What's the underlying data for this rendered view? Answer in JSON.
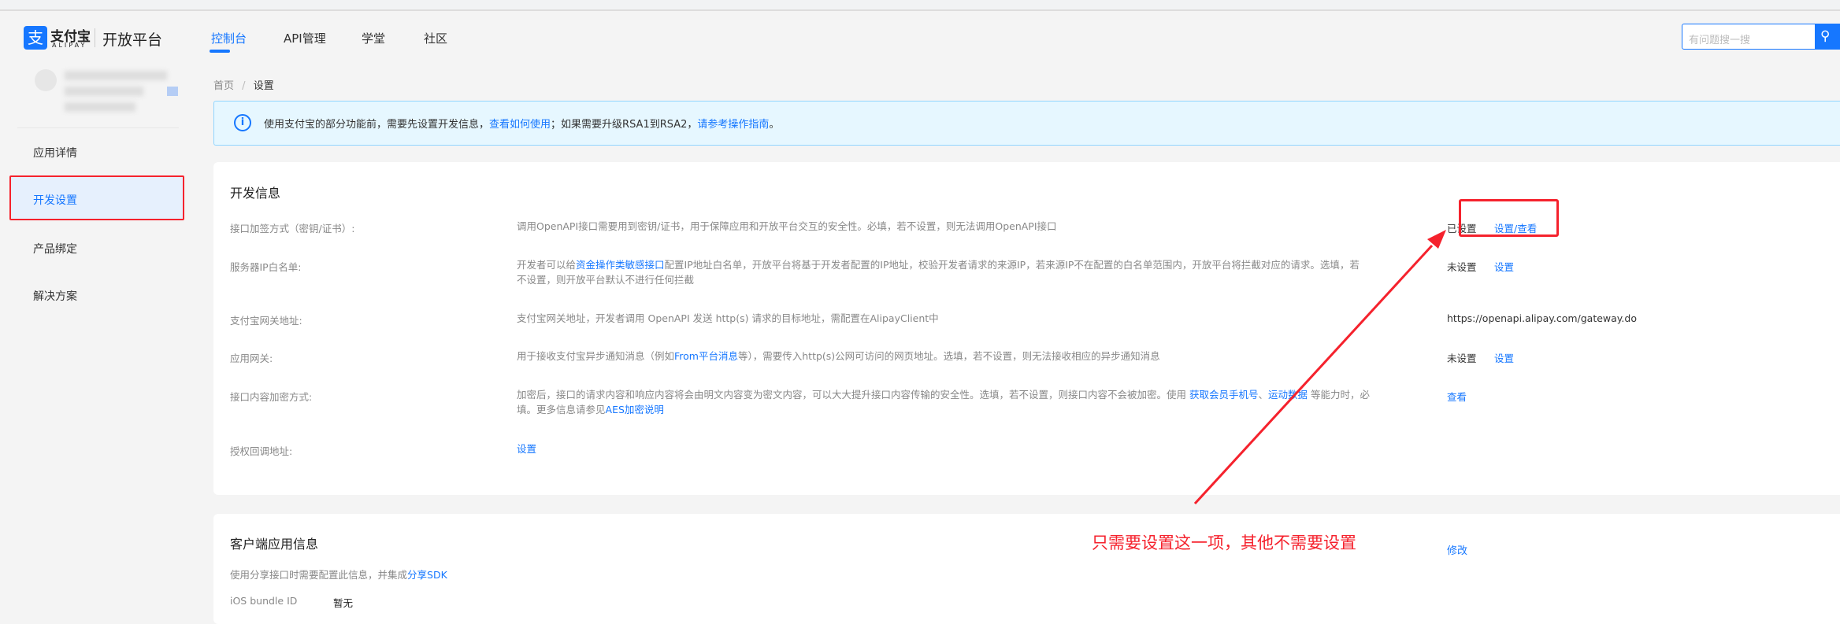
{
  "header": {
    "logo_cn": "支付宝",
    "logo_en": "ALIPAY",
    "platform": "开放平台",
    "nav": [
      {
        "label": "控制台",
        "active": true
      },
      {
        "label": "API管理"
      },
      {
        "label": "学堂"
      },
      {
        "label": "社区"
      }
    ],
    "search_placeholder": "有问题搜一搜"
  },
  "sidebar": {
    "items": [
      {
        "label": "应用详情"
      },
      {
        "label": "开发设置",
        "active": true
      },
      {
        "label": "产品绑定"
      },
      {
        "label": "解决方案"
      }
    ]
  },
  "breadcrumb": {
    "home": "首页",
    "sep": "/",
    "current": "设置"
  },
  "alert": {
    "text1": "使用支付宝的部分功能前，需要先设置开发信息，",
    "link1": "查看如何使用",
    "text2": "；如果需要升级RSA1到RSA2，",
    "link2": "请参考操作指南",
    "text3": "。"
  },
  "dev_info": {
    "title": "开发信息",
    "rows": [
      {
        "label": "接口加签方式（密钥/证书）:",
        "desc": "调用OpenAPI接口需要用到密钥/证书，用于保障应用和开放平台交互的安全性。必填，若不设置，则无法调用OpenAPI接口",
        "status": "已设置",
        "action": "设置/查看"
      },
      {
        "label": "服务器IP白名单:",
        "desc_pre": "开发者可以给",
        "desc_link": "资金操作类敏感接口",
        "desc_post": "配置IP地址白名单，开放平台将基于开发者配置的IP地址，校验开发者请求的来源IP，若来源IP不在配置的白名单范围内，开放平台将拦截对应的请求。选填，若不设置，则开放平台默认不进行任何拦截",
        "status": "未设置",
        "action": "设置"
      },
      {
        "label": "支付宝网关地址:",
        "desc": "支付宝网关地址，开发者调用 OpenAPI 发送 http(s) 请求的目标地址，需配置在AlipayClient中",
        "status": "https://openapi.alipay.com/gateway.do"
      },
      {
        "label": "应用网关:",
        "desc_pre": "用于接收支付宝异步通知消息（例如",
        "desc_link": "From平台消息",
        "desc_post": "等），需要传入http(s)公网可访问的网页地址。选填，若不设置，则无法接收相应的异步通知消息",
        "status": "未设置",
        "action": "设置"
      },
      {
        "label": "接口内容加密方式:",
        "desc_pre": "加密后，接口的请求内容和响应内容将会由明文内容变为密文内容，可以大大提升接口内容传输的安全性。选填，若不设置，则接口内容不会被加密。使用 ",
        "desc_link": "获取会员手机号",
        "desc_mid": "、",
        "desc_link2": "运动数据",
        "desc_post": " 等能力时，必填。更多信息请参见",
        "desc_link3": "AES加密说明",
        "action": "查看"
      },
      {
        "label": "授权回调地址:",
        "desc_link": "设置"
      }
    ]
  },
  "client_info": {
    "title": "客户端应用信息",
    "edit": "修改",
    "desc": "使用分享接口时需要配置此信息，并集成",
    "desc_link": "分享SDK",
    "ios_label": "iOS bundle ID",
    "ios_value": "暂无"
  },
  "annotation": "只需要设置这一项，其他不需要设置",
  "colors": {
    "accent": "#1677ff",
    "annotation": "#f5222d"
  }
}
